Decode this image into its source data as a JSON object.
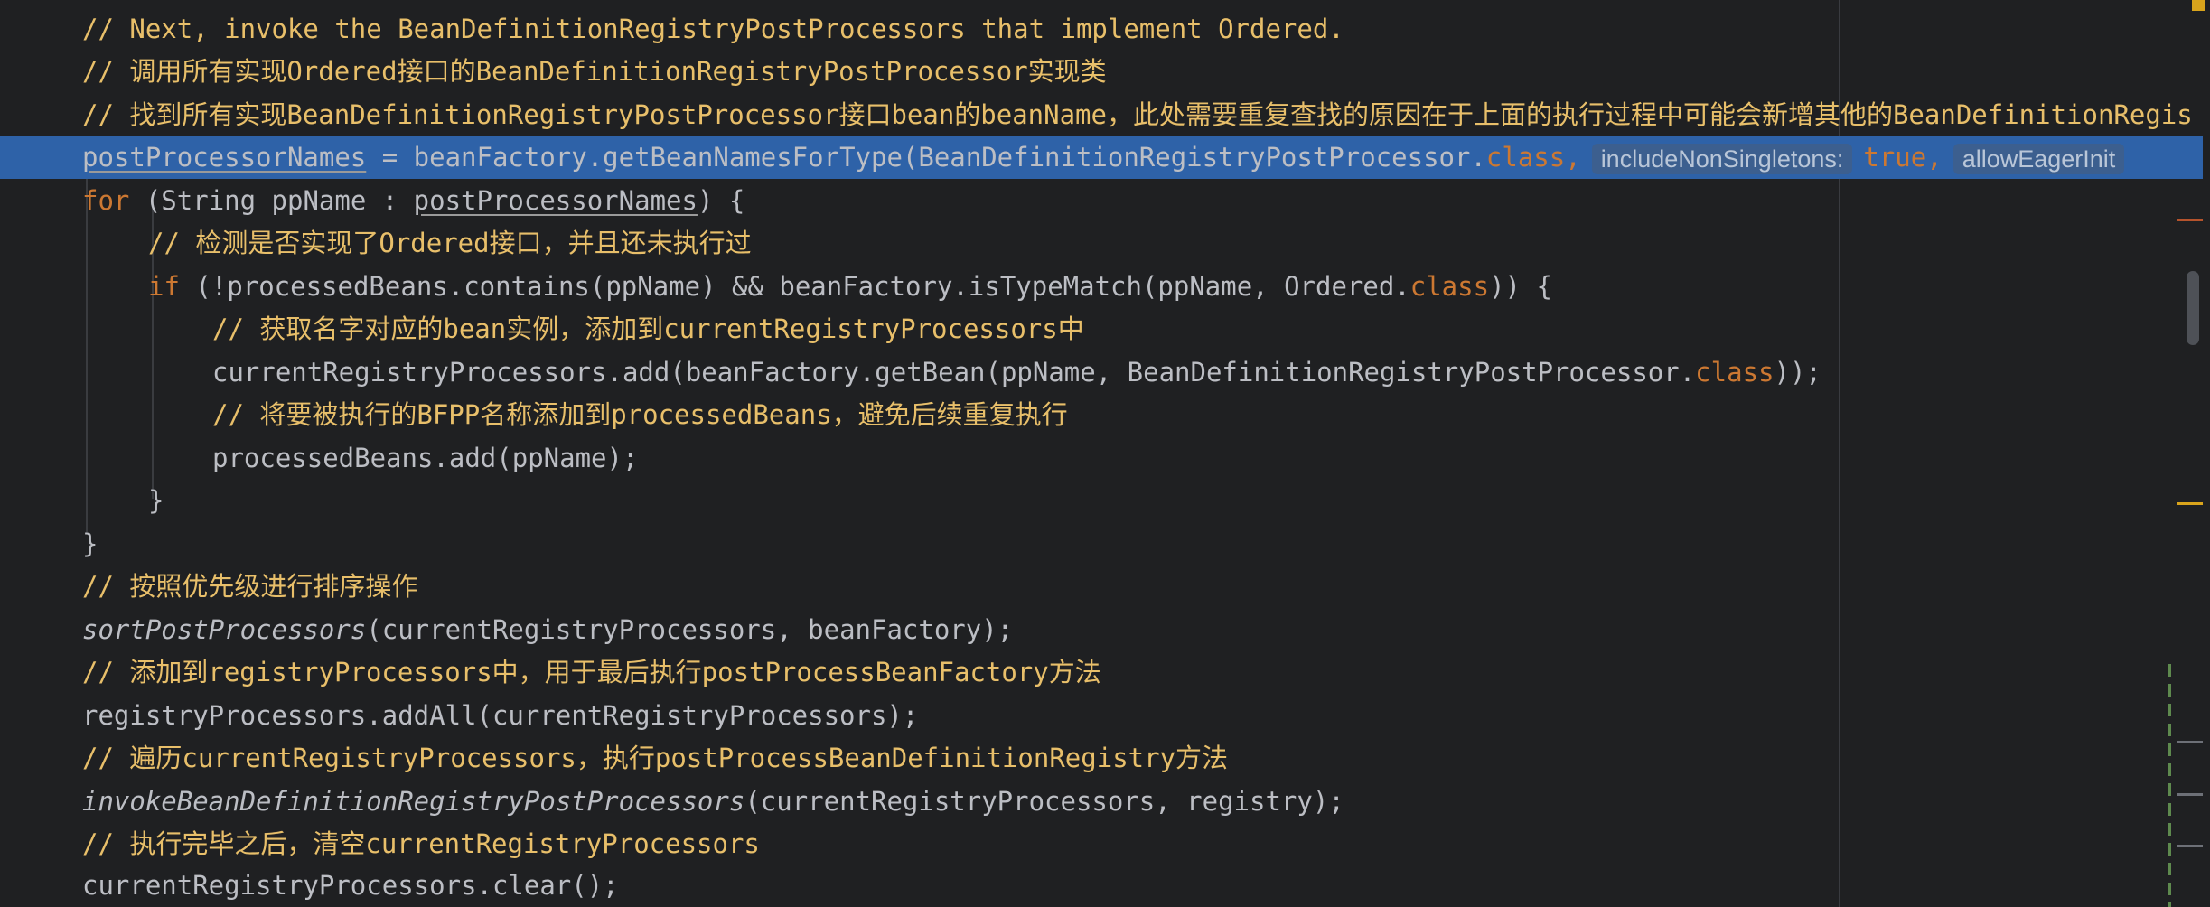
{
  "colors": {
    "background": "#1f2022",
    "comment": "#e8bf6a",
    "keyword": "#cc7832",
    "identifier": "#bcbec4",
    "selected_line": "#2e62a8",
    "inlay_hint": "#3d4c64"
  },
  "editor": {
    "lines": [
      {
        "comment": "// Next, invoke the BeanDefinitionRegistryPostProcessors that implement Ordered."
      },
      {
        "comment": "// 调用所有实现Ordered接口的BeanDefinitionRegistryPostProcessor实现类"
      },
      {
        "comment": "// 找到所有实现BeanDefinitionRegistryPostProcessor接口bean的beanName，此处需要重复查找的原因在于上面的执行过程中可能会新增其他的BeanDefinitionRegis"
      },
      {
        "var": "postProcessorNames",
        "mid": " = beanFactory.getBeanNamesForType(BeanDefinitionRegistryPostProcessor.",
        "kw_class": "class",
        "comma": ",",
        "hint1": "includeNonSingletons:",
        "kw_true": "true",
        "comma2": ",",
        "hint2": "allowEagerInit"
      },
      {
        "kw": "for",
        "mid": " (String ppName : ",
        "var": "postProcessorNames",
        "tail": ") {"
      },
      {
        "comment": "// 检测是否实现了Ordered接口，并且还未执行过"
      },
      {
        "kw": "if",
        "mid": " (!processedBeans.contains(ppName) && beanFactory.isTypeMatch(ppName, Ordered.",
        "kw_class": "class",
        "tail": ")) {"
      },
      {
        "comment": "// 获取名字对应的bean实例，添加到currentRegistryProcessors中"
      },
      {
        "mid": "currentRegistryProcessors.add(beanFactory.getBean(ppName, BeanDefinitionRegistryPostProcessor.",
        "kw_class": "class",
        "tail": "));"
      },
      {
        "comment": "// 将要被执行的BFPP名称添加到processedBeans，避免后续重复执行"
      },
      {
        "text": "processedBeans.add(ppName);"
      },
      {
        "text": "}"
      },
      {
        "text": "}"
      },
      {
        "comment": "// 按照优先级进行排序操作"
      },
      {
        "italic": "sortPostProcessors",
        "tail": "(currentRegistryProcessors, beanFactory);"
      },
      {
        "comment": "// 添加到registryProcessors中，用于最后执行postProcessBeanFactory方法"
      },
      {
        "text": "registryProcessors.addAll(currentRegistryProcessors);"
      },
      {
        "comment": "// 遍历currentRegistryProcessors，执行postProcessBeanDefinitionRegistry方法"
      },
      {
        "italic": "invokeBeanDefinitionRegistryPostProcessors",
        "tail": "(currentRegistryProcessors, registry);"
      },
      {
        "comment": "// 执行完毕之后，清空currentRegistryProcessors"
      },
      {
        "text": "currentRegistryProcessors.clear();"
      }
    ]
  }
}
